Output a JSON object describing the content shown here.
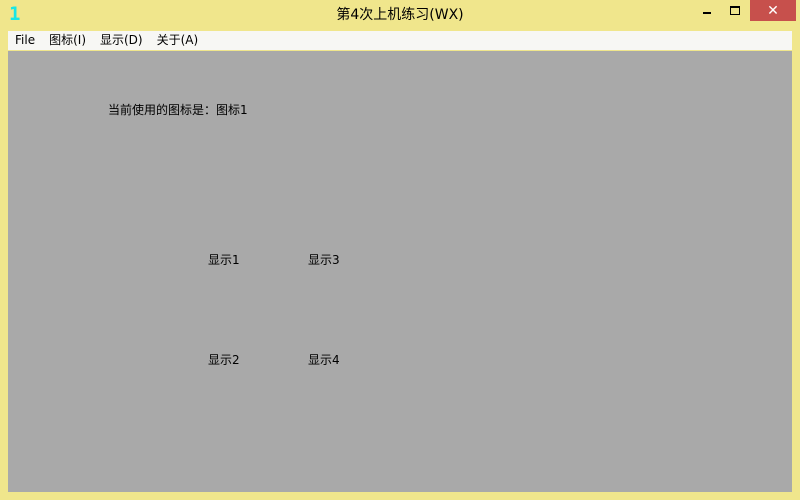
{
  "window": {
    "title": "第4次上机练习(WX)",
    "app_icon_text": "1",
    "controls": {
      "minimize": "minimize-icon",
      "maximize": "maximize-icon",
      "close": "close-icon",
      "close_glyph": "✕"
    }
  },
  "menu": {
    "items": [
      "File",
      "图标(I)",
      "显示(D)",
      "关于(A)"
    ]
  },
  "client": {
    "status_text": "当前使用的图标是：图标1",
    "labels": [
      "显示1",
      "显示2",
      "显示3",
      "显示4"
    ]
  },
  "colors": {
    "frame": "#f0e68c",
    "client_bg": "#a9a9a9",
    "close_button": "#c7504c",
    "app_icon": "#19e6e6"
  }
}
